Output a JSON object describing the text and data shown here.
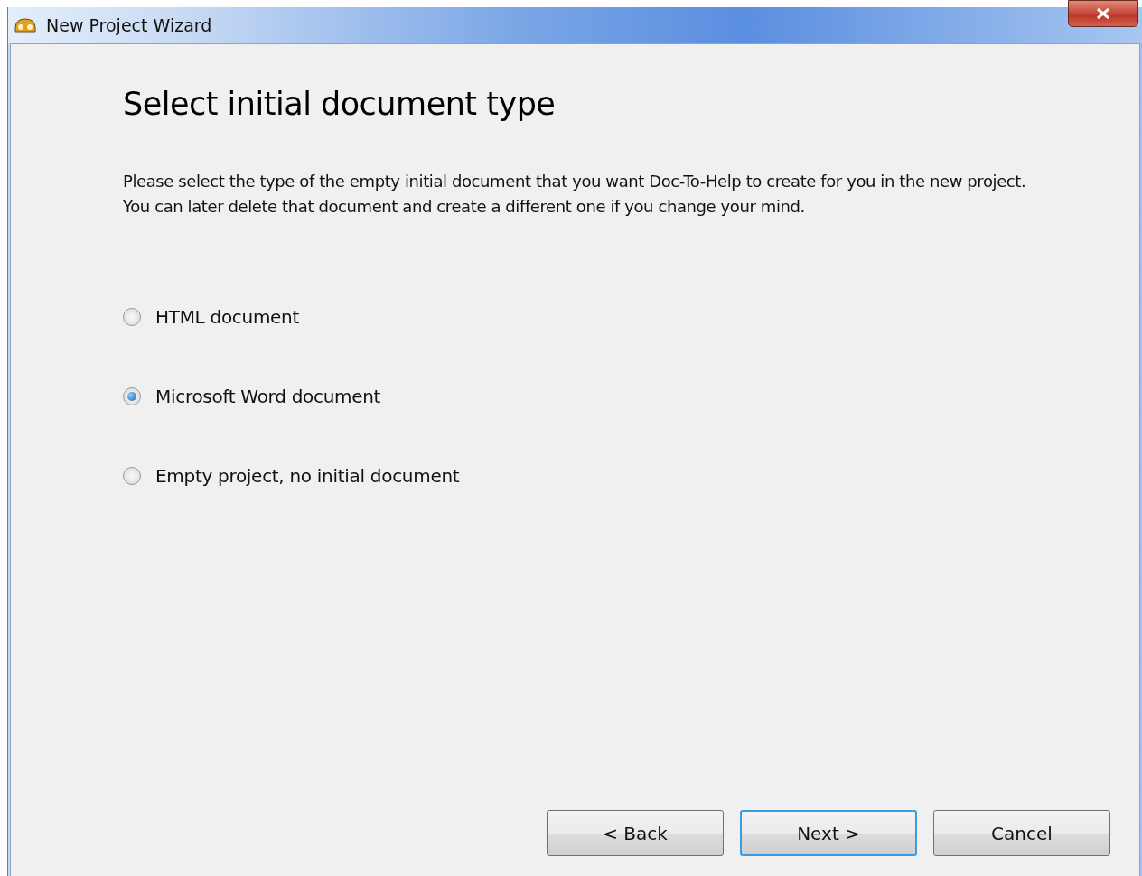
{
  "window": {
    "title": "New Project Wizard"
  },
  "heading": "Select initial document type",
  "description": "Please select the type of the empty initial document that you want Doc-To-Help to create for you in the new project. You can later delete that document and create a different one if you change your mind.",
  "options": [
    {
      "label": "HTML document",
      "selected": false
    },
    {
      "label": "Microsoft Word document",
      "selected": true
    },
    {
      "label": "Empty project, no initial document",
      "selected": false
    }
  ],
  "buttons": [
    {
      "label": "< Back",
      "default": false
    },
    {
      "label": "Next >",
      "default": true
    },
    {
      "label": "Cancel",
      "default": false
    }
  ]
}
